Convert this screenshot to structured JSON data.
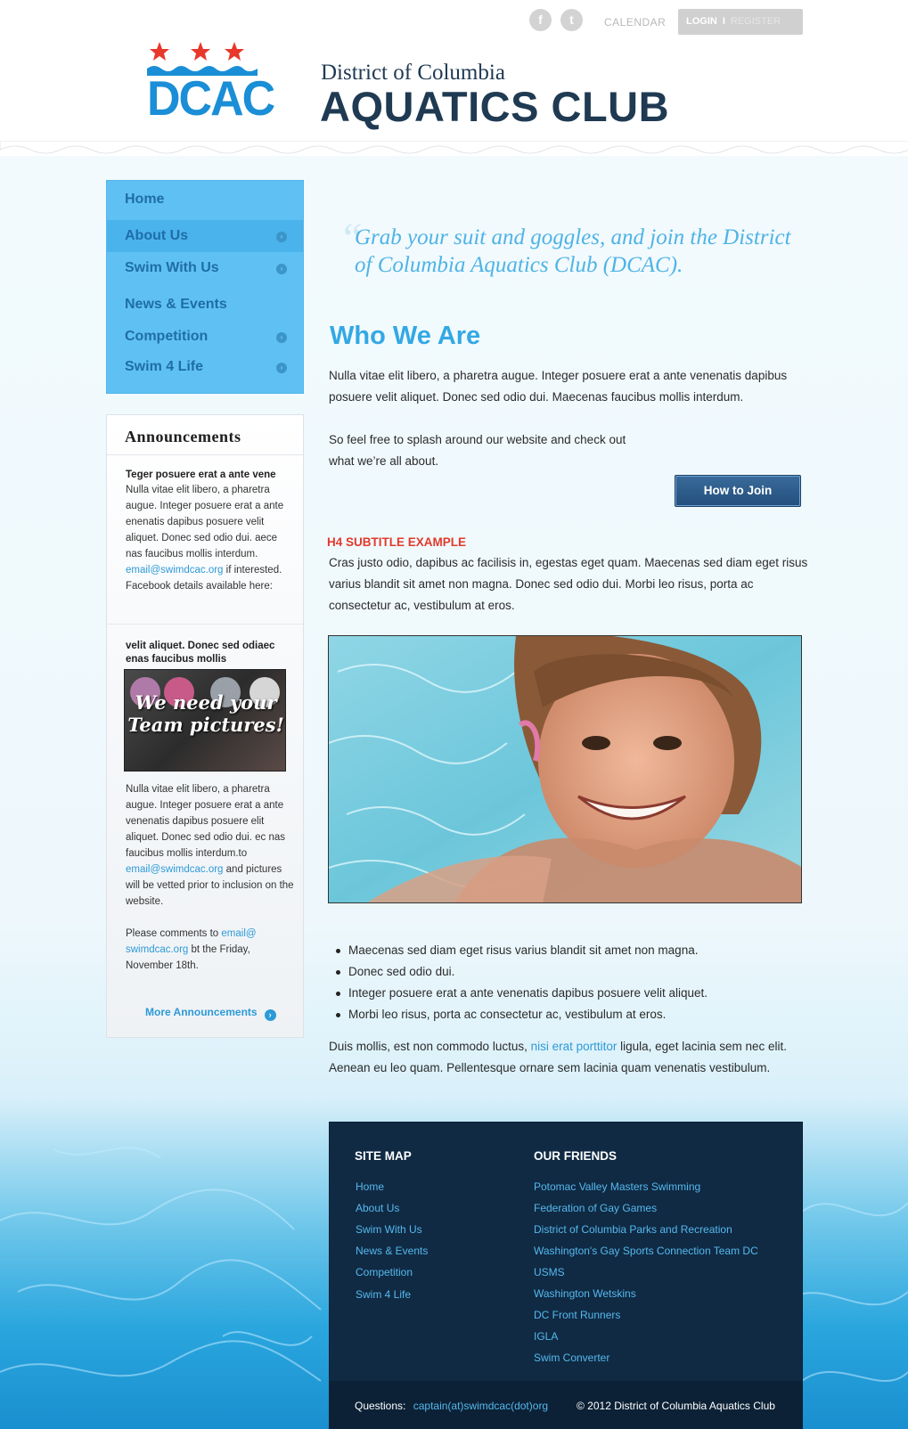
{
  "header": {
    "social": [
      "f",
      "t"
    ],
    "calendar": "CALENDAR",
    "login": "LOGIN",
    "separator": "I",
    "register": "REGISTER",
    "logo_text": "DCAC",
    "site_subtitle": "District of Columbia",
    "site_title": "AQUATICS CLUB"
  },
  "colors": {
    "brand_blue": "#33a8e4",
    "navy": "#1f3a52",
    "nav_bg": "#5fc1f3",
    "accent_red": "#e23a2b",
    "footer_bg": "#102a44"
  },
  "nav": {
    "items": [
      {
        "label": "Home",
        "arrow": false
      },
      {
        "label": "About  Us",
        "arrow": true
      },
      {
        "label": "Swim With Us",
        "arrow": true
      },
      {
        "label": "News & Events",
        "arrow": false
      },
      {
        "label": "Competition",
        "arrow": true
      },
      {
        "label": "Swim 4 Life",
        "arrow": true
      }
    ]
  },
  "announcements": {
    "title": "Announcements",
    "item1_heading": "Teger posuere erat a ante vene",
    "item1_text": "Nulla vitae elit libero, a pharetra augue. Integer posuere erat a ante enenatis dapibus posuere velit aliquet. Donec sed odio dui. aece nas faucibus mollis interdum.",
    "item1_email": "email@swimdcac.org",
    "item1_after": " if interested. Facebook details available here:",
    "item2_heading": "velit aliquet. Donec sed odiaec enas faucibus mollis",
    "image_caption": "We need your Team pictures!",
    "item2_text": "Nulla vitae elit libero, a pharetra augue. Integer posuere erat a ante venenatis dapibus posuere elit aliquet. Donec sed odio dui. ec nas faucibus mollis interdum.to",
    "item2_email": "email@swimdcac.org",
    "item2_after": " and pictures will be vetted prior to inclusion on the website.",
    "item3_before": "Please comments to ",
    "item3_email": "email@ swimdcac.org",
    "item3_after": " bt the Friday, November 18th.",
    "more": "More Announcements"
  },
  "main": {
    "quote": "Grab your suit and goggles, and join the District of Columbia Aquatics Club (DCAC).",
    "heading": "Who We Are",
    "para1": "Nulla vitae elit libero, a pharetra augue. Integer posuere erat a ante venenatis dapibus posuere velit aliquet. Donec sed odio dui. Maecenas faucibus mollis interdum.",
    "para2": "So feel free to splash around our website and check out what we’re all about.",
    "join_button": "How to Join",
    "subtitle": "H4 SUBTITLE EXAMPLE",
    "para3": "Cras justo odio, dapibus ac facilisis in, egestas eget quam. Maecenas sed diam eget risus varius blandit sit amet non magna. Donec sed odio dui. Morbi leo risus, porta ac consectetur ac, vestibulum at eros.",
    "bullets": [
      "Maecenas sed diam eget risus varius blandit sit amet non magna.",
      "Donec sed odio dui.",
      "Integer posuere erat a ante venenatis dapibus posuere velit aliquet.",
      "Morbi leo risus, porta ac consectetur ac, vestibulum at eros."
    ],
    "para4_before": "Duis mollis, est non commodo luctus, ",
    "para4_link": "nisi erat porttitor",
    "para4_after": " ligula, eget lacinia sem nec elit. Aenean eu leo quam. Pellentesque ornare sem lacinia quam venenatis vestibulum."
  },
  "footer": {
    "sitemap_title": "SITE MAP",
    "sitemap": [
      "Home",
      "About  Us",
      "Swim With Us",
      "News & Events",
      "Competition",
      "Swim 4 Life"
    ],
    "friends_title": "OUR FRIENDS",
    "friends": [
      "Potomac Valley Masters Swimming",
      "Federation of Gay Games",
      "District of Columbia Parks and Recreation",
      "Washington's Gay Sports Connection Team DC",
      "USMS",
      "Washington Wetskins",
      "DC Front Runners",
      "IGLA",
      "Swim Converter"
    ],
    "questions_label": "Questions:",
    "questions_email": "captain(at)swimdcac(dot)org",
    "copyright": "© 2012 District of Columbia Aquatics Club"
  }
}
